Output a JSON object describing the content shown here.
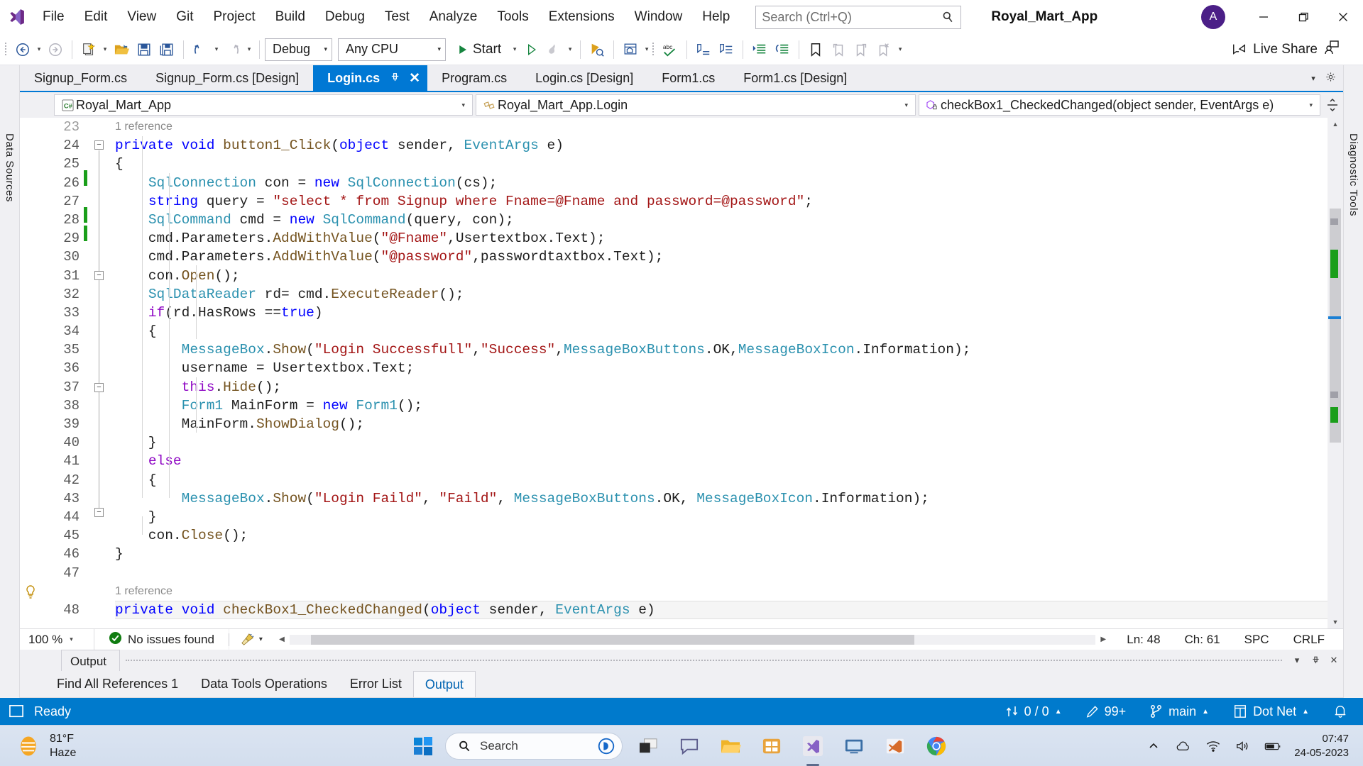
{
  "titlebar": {
    "menu": [
      "File",
      "Edit",
      "View",
      "Git",
      "Project",
      "Build",
      "Debug",
      "Test",
      "Analyze",
      "Tools",
      "Extensions",
      "Window",
      "Help"
    ],
    "search_placeholder": "Search (Ctrl+Q)",
    "app_title": "Royal_Mart_App",
    "avatar_initial": "A",
    "minimize": "–",
    "restore": "❐",
    "close": "✕"
  },
  "toolbar": {
    "config": "Debug",
    "platform": "Any CPU",
    "start_label": "Start",
    "live_share": "Live Share"
  },
  "left_rail": {
    "label": "Data Sources"
  },
  "right_rail": {
    "label": "Diagnostic Tools"
  },
  "tabs": [
    {
      "label": "Signup_Form.cs",
      "active": false
    },
    {
      "label": "Signup_Form.cs [Design]",
      "active": false
    },
    {
      "label": "Login.cs",
      "active": true
    },
    {
      "label": "Program.cs",
      "active": false
    },
    {
      "label": "Login.cs [Design]",
      "active": false
    },
    {
      "label": "Form1.cs",
      "active": false
    },
    {
      "label": "Form1.cs [Design]",
      "active": false
    }
  ],
  "navbar": {
    "project": "Royal_Mart_App",
    "project_icon": "csharp-file-icon",
    "class": "Royal_Mart_App.Login",
    "class_icon": "class-icon",
    "member": "checkBox1_CheckedChanged(object sender, EventArgs e)",
    "member_icon": "method-private-icon"
  },
  "editor": {
    "first_line": 23,
    "codelens_top": "1 reference",
    "codelens_bottom": "1 reference",
    "lines": [
      {
        "n": 24,
        "text": "private void button1_Click(object sender, EventArgs e)"
      },
      {
        "n": 25,
        "text": "{"
      },
      {
        "n": 26,
        "text": "SqlConnection con = new SqlConnection(cs);"
      },
      {
        "n": 27,
        "text": "string query = \"select * from Signup where Fname=@Fname and password=@password\";"
      },
      {
        "n": 28,
        "text": "SqlCommand cmd = new SqlCommand(query, con);"
      },
      {
        "n": 29,
        "text": "cmd.Parameters.AddWithValue(\"@Fname\",Usertextbox.Text);"
      },
      {
        "n": 30,
        "text": "cmd.Parameters.AddWithValue(\"@password\",passwordtaxtbox.Text);"
      },
      {
        "n": 31,
        "text": "con.Open();"
      },
      {
        "n": 32,
        "text": "SqlDataReader rd= cmd.ExecuteReader();"
      },
      {
        "n": 33,
        "text": "if(rd.HasRows ==true)"
      },
      {
        "n": 34,
        "text": "{"
      },
      {
        "n": 35,
        "text": "MessageBox.Show(\"Login Successfull\",\"Success\",MessageBoxButtons.OK,MessageBoxIcon.Information);"
      },
      {
        "n": 36,
        "text": "username = Usertextbox.Text;"
      },
      {
        "n": 37,
        "text": "this.Hide();"
      },
      {
        "n": 38,
        "text": "Form1 MainForm = new Form1();"
      },
      {
        "n": 39,
        "text": "MainForm.ShowDialog();"
      },
      {
        "n": 40,
        "text": "}"
      },
      {
        "n": 41,
        "text": "else"
      },
      {
        "n": 42,
        "text": "{"
      },
      {
        "n": 43,
        "text": "MessageBox.Show(\"Login Faild\", \"Faild\", MessageBoxButtons.OK, MessageBoxIcon.Information);"
      },
      {
        "n": 44,
        "text": "}"
      },
      {
        "n": 45,
        "text": "con.Close();"
      },
      {
        "n": 46,
        "text": "}"
      },
      {
        "n": 47,
        "text": ""
      },
      {
        "n": 48,
        "text": "private void checkBox1_CheckedChanged(object sender, EventArgs e)"
      }
    ]
  },
  "editor_status": {
    "zoom": "100 %",
    "issues": "No issues found",
    "ln": "Ln: 48",
    "ch": "Ch: 61",
    "spc": "SPC",
    "eol": "CRLF"
  },
  "panel": {
    "title": "Output",
    "tabs": [
      {
        "label": "Find All References 1",
        "active": false
      },
      {
        "label": "Data Tools Operations",
        "active": false
      },
      {
        "label": "Error List",
        "active": false
      },
      {
        "label": "Output",
        "active": true
      }
    ]
  },
  "statusbar": {
    "ready": "Ready",
    "source_control": "0 / 0",
    "pending_changes": "99+",
    "branch": "main",
    "repo": "Dot Net",
    "caret": "▲"
  },
  "taskbar": {
    "weather_temp": "81°F",
    "weather_cond": "Haze",
    "search_placeholder": "Search",
    "time": "07:47",
    "date": "24-05-2023"
  },
  "colors": {
    "accent_blue": "#0078d4",
    "status_blue": "#007acc",
    "keyword": "#0000ff",
    "type": "#2b91af",
    "string": "#a31515",
    "method": "#74531f",
    "control_keyword": "#8f08c4",
    "changebar_green": "#1a9e1a",
    "avatar_purple": "#4b1f87"
  }
}
